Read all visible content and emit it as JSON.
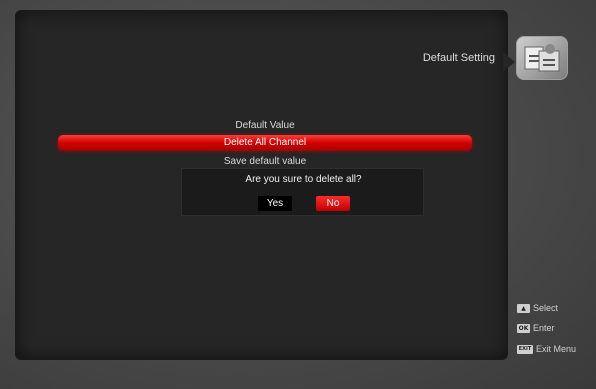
{
  "header": {
    "title": "Default Setting",
    "logo_icon": "settings-logo-icon"
  },
  "menu": {
    "items": [
      {
        "label": "Default Value",
        "selected": false
      },
      {
        "label": "Delete All Channel",
        "selected": true
      },
      {
        "label": "Save default value",
        "selected": false
      }
    ]
  },
  "dialog": {
    "message": "Are you sure to delete all?",
    "yes_label": "Yes",
    "no_label": "No",
    "focused": "No"
  },
  "legend": {
    "select_label": "Select",
    "enter_label": "Enter",
    "exit_label": "Exit Menu",
    "ok_key": "OK",
    "exit_key": "EXIT"
  },
  "colors": {
    "accent": "#d10000",
    "panel": "#262626",
    "background": "#4a4a4a"
  }
}
